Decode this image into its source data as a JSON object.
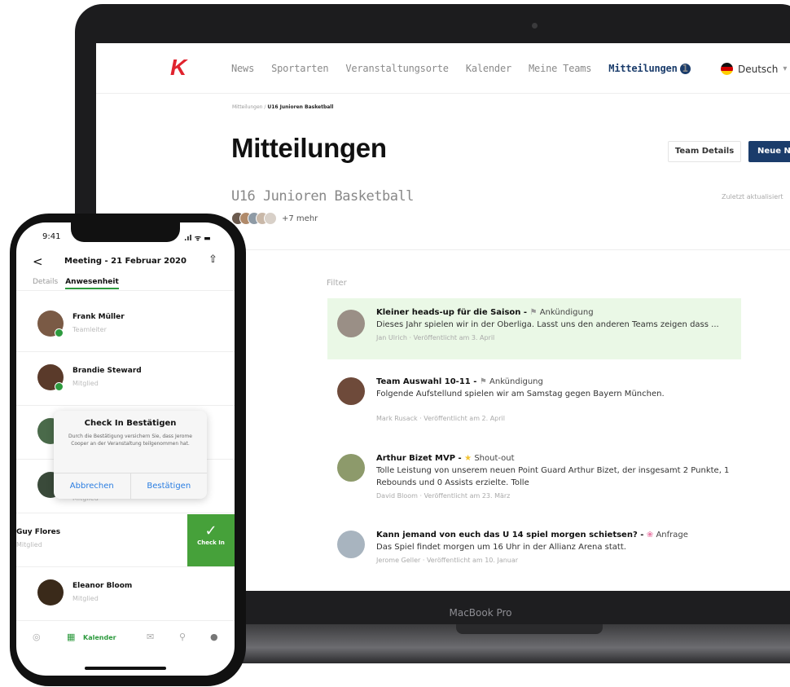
{
  "web": {
    "logo": "K",
    "nav": [
      "News",
      "Sportarten",
      "Veranstaltungsorte",
      "Kalender",
      "Meine Teams",
      "Mitteilungen"
    ],
    "nav_badge": "1",
    "language": "Deutsch",
    "breadcrumb_parent": "Mitteilungen /",
    "breadcrumb_current": "U16 Junioren Basketball",
    "page_title": "Mitteilungen",
    "btn_team_details": "Team Details",
    "btn_new": "Neue N",
    "team_name": "U16 Junioren Basketball",
    "updated": "Zuletzt aktualisiert",
    "members_more": "+7 mehr",
    "filter_label": "Filter",
    "posts": [
      {
        "title": "Kleiner heads-up für die Saison -",
        "tag": "Ankündigung",
        "tag_icon": "⚑",
        "body": "Dieses Jahr spielen wir in der Oberliga. Lasst uns den anderen Teams zeigen dass ...",
        "meta": "Jan Ulrich · Veröffentlicht am 3. April",
        "highlight": true,
        "avatar_color": "#9a8f86"
      },
      {
        "title": "Team Auswahl 10-11 -",
        "tag": "Ankündigung",
        "tag_icon": "⚑",
        "body": "Folgende Aufstellund spielen wir am Samstag gegen  Bayern München.",
        "meta": "Mark Rusack · Veröffentlicht am 2. April",
        "highlight": false,
        "avatar_color": "#6e4a3a"
      },
      {
        "title": "Arthur Bizet MVP -",
        "tag": "Shout-out",
        "tag_icon": "★",
        "body": "Tolle Leistung von unserem neuen Point Guard Arthur Bizet, der insgesamt 2 Punkte, 1 Rebounds und 0 Assists erzielte. Tolle",
        "meta": "David Bloom · Veröffentlicht am 23. März",
        "highlight": false,
        "avatar_color": "#8d9a6b"
      },
      {
        "title": "Kann jemand von euch das U 14 spiel morgen schietsen? -",
        "tag": "Anfrage",
        "tag_icon": "❀",
        "body": "Das Spiel findet morgen um 16 Uhr in der Allianz Arena statt.",
        "meta": "Jerome Geller · Veröffentlicht am 10. Januar",
        "highlight": false,
        "avatar_color": "#a8b4bf"
      }
    ]
  },
  "laptop": {
    "chin_label": "MacBook Pro"
  },
  "phone": {
    "time": "9:41",
    "status_icons": ".ıl ᯤ ▬",
    "back": "<",
    "title": "Meeting - 21 Februar 2020",
    "share": "⇧",
    "tabs": [
      "Details",
      "Anwesenheit"
    ],
    "rows": [
      {
        "name": "Frank Müller",
        "role": "Teamleiter",
        "avatar_color": "#7a5a45",
        "checked": true
      },
      {
        "name": "Brandie Steward",
        "role": "Mitglied",
        "avatar_color": "#5a3a2a",
        "checked": true
      },
      {
        "name": "",
        "role": "",
        "avatar_color": "#4a6a4a",
        "checked": true
      },
      {
        "name": "",
        "role": "Mitglied",
        "avatar_color": "#3a4a3a",
        "checked": true
      },
      {
        "name": "Guy Flores",
        "role": "Mitglied",
        "avatar_color": "",
        "checked": false
      },
      {
        "name": "Eleanor Bloom",
        "role": "Mitglied",
        "avatar_color": "#3a2a1a",
        "checked": false
      }
    ],
    "popup": {
      "title": "Check In Bestätigen",
      "body": "Durch die Bestätigung versichern Sie, dass Jerome Cooper an der Veranstaltung teilgenommen hat.",
      "cancel": "Abbrechen",
      "confirm": "Bestätigen"
    },
    "checkin_icon": "✓",
    "checkin_label": "Check In",
    "tabbar_active": "Kalender"
  },
  "colors": {
    "brand_red": "#e0232e",
    "navy": "#1a3c6b",
    "green": "#46a13a",
    "highlight": "#eaf8e6"
  }
}
